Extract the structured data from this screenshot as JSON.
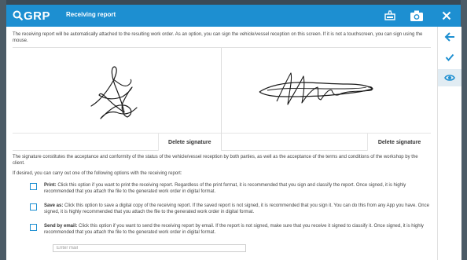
{
  "header": {
    "logo": "GRP",
    "title": "Receiving report",
    "icons": [
      "signature-pad-icon",
      "camera-icon",
      "close-icon"
    ]
  },
  "intro": "The receiving report will be automatically attached to the resulting work order. As an option, you can sign the vehicle/vessel reception on this screen. If it is not a touchscreen, you can sign using the mouse.",
  "signatures": {
    "left_delete": "Delete signature",
    "right_delete": "Delete signature"
  },
  "conformity_text": "The signature constitutes the acceptance and conformity of the status of the vehicle/vessel reception by both parties, as well as the acceptance of the terms and conditions of the workshop by the client.",
  "options_intro": "If desired, you can carry out one of the following options with the receiving report:",
  "options": [
    {
      "label": "Print:",
      "text": "Click this option if you want to print the receiving report. Regardless of the print format, it is recommended that you sign and classify the report. Once signed, it is highly recommended that you attach the file to the generated work order in digital format.",
      "checked": false
    },
    {
      "label": "Save as:",
      "text": "Click this option to save a digital copy of the receiving report. If the saved report is not signed, it is recommended that you sign it. You can do this from any App you have. Once signed, it is highly recommended that you attach the file to the generated work order in digital format.",
      "checked": false
    },
    {
      "label": "Send by email:",
      "text": "Click this option if you want to send the receiving report by email. If the report is not signed, make sure that you receive it signed to classify it. Once signed, it is highly recommended that you attach the file to the generated work order in digital format.",
      "checked": false
    }
  ],
  "email": {
    "placeholder": "Enter mail",
    "value": ""
  },
  "sidebar": {
    "icons": [
      "arrow-left-icon",
      "check-icon",
      "eye-icon"
    ]
  },
  "colors": {
    "accent": "#1d8fd1",
    "sidebar_active": "#e1ecf3",
    "backdrop": "#3a4a57"
  }
}
